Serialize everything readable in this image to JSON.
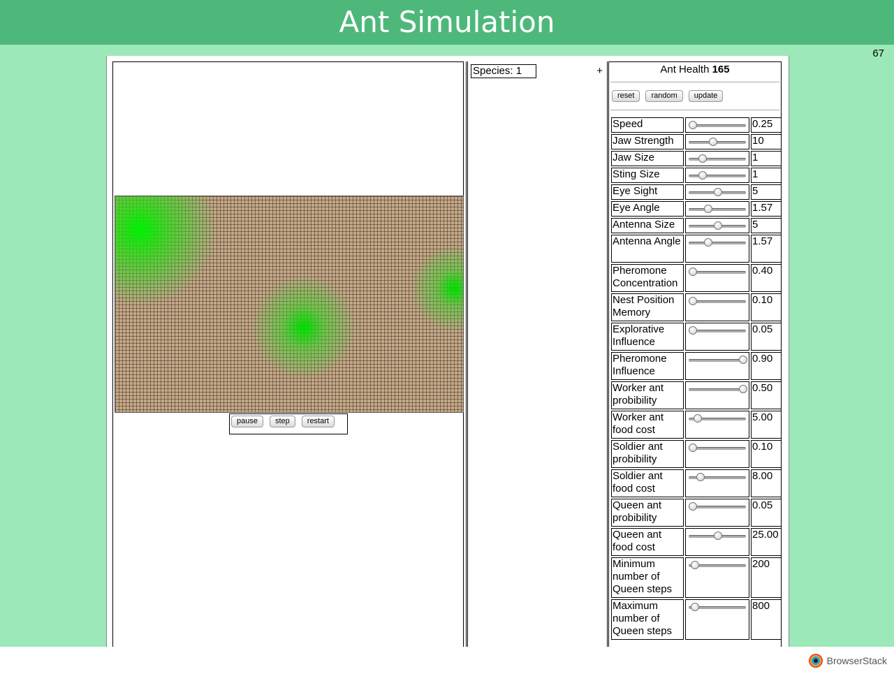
{
  "header": {
    "title": "Ant Simulation"
  },
  "fps": "67",
  "controls": {
    "pause": "pause",
    "step": "step",
    "restart": "restart"
  },
  "species": {
    "label": "Species: 1",
    "add": "+"
  },
  "settings": {
    "health_label": "Ant Health",
    "health_value": "165",
    "reset": "reset",
    "random": "random",
    "update": "update",
    "params": [
      {
        "name": "Speed",
        "value": "0.25",
        "level": 0.0
      },
      {
        "name": "Jaw Strength",
        "value": "10",
        "level": 0.4
      },
      {
        "name": "Jaw Size",
        "value": "1",
        "level": 0.2
      },
      {
        "name": "Sting Size",
        "value": "1",
        "level": 0.2
      },
      {
        "name": "Eye Sight",
        "value": "5",
        "level": 0.5
      },
      {
        "name": "Eye Angle",
        "value": "1.57",
        "level": 0.3
      },
      {
        "name": "Antenna Size",
        "value": "5",
        "level": 0.5
      },
      {
        "name": "Antenna Angle",
        "value": "1.57",
        "level": 0.3
      },
      {
        "name": "Pheromone Concentration",
        "value": "0.40",
        "level": 0.0
      },
      {
        "name": "Nest Position Memory",
        "value": "0.10",
        "level": 0.0
      },
      {
        "name": "Explorative Influence",
        "value": "0.05",
        "level": 0.0
      },
      {
        "name": "Pheromone Influence",
        "value": "0.90",
        "level": 1.0
      },
      {
        "name": "Worker ant probibility",
        "value": "0.50",
        "level": 1.0
      },
      {
        "name": "Worker ant food cost",
        "value": "5.00",
        "level": 0.1
      },
      {
        "name": "Soldier ant probibility",
        "value": "0.10",
        "level": 0.0
      },
      {
        "name": "Soldier ant food cost",
        "value": "8.00",
        "level": 0.15
      },
      {
        "name": "Queen ant probibility",
        "value": "0.05",
        "level": 0.0
      },
      {
        "name": "Queen ant food cost",
        "value": "25.00",
        "level": 0.5
      },
      {
        "name": "Minimum number of Queen steps",
        "value": "200",
        "level": 0.04
      },
      {
        "name": "Maximum number of Queen steps",
        "value": "800",
        "level": 0.04
      }
    ]
  },
  "browserstack": {
    "label": "BrowserStack"
  }
}
